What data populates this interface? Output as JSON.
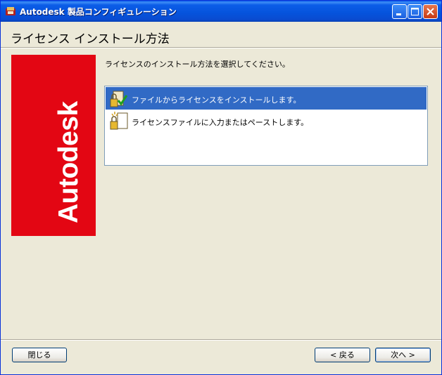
{
  "window": {
    "title": "Autodesk 製品コンフィギュレーション"
  },
  "header": {
    "title": "ライセンス インストール方法"
  },
  "logo": {
    "text": "Autodesk",
    "color": "#E30613"
  },
  "instruction": "ライセンスのインストール方法を選択してください。",
  "options": [
    {
      "label": "ファイルからライセンスをインストールします。",
      "icon": "license-file-check-icon",
      "selected": true
    },
    {
      "label": "ライセンスファイルに入力またはペーストします。",
      "icon": "license-paste-icon",
      "selected": false
    }
  ],
  "buttons": {
    "close": "閉じる",
    "back": "< 戻る",
    "next": "次へ >"
  },
  "colors": {
    "selection": "#316AC5",
    "titlebar": "#0553DC",
    "background": "#ECE9D8"
  }
}
